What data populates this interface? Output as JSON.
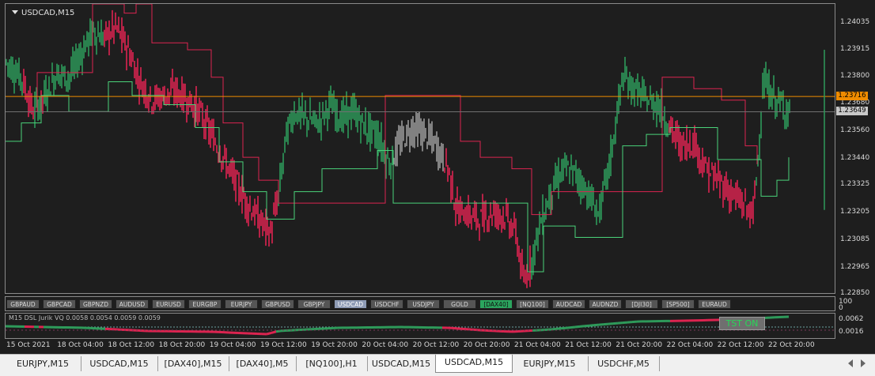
{
  "window": {
    "symbol_title": "USDCAD,M15"
  },
  "chart_data": {
    "type": "candlestick",
    "symbol": "USDCAD",
    "timeframe": "M15",
    "ylim": [
      1.2285,
      1.2412
    ],
    "price_ticks": [
      "1.24035",
      "1.23915",
      "1.23800",
      "1.23680",
      "1.23560",
      "1.23440",
      "1.23325",
      "1.23205",
      "1.23085",
      "1.22965",
      "1.22850"
    ],
    "bid_price": "1.23649",
    "bid_value": 1.23649,
    "horizontal_line_price": "1.23716",
    "horizontal_line_value": 1.23716,
    "time_labels": [
      "15 Oct 2021",
      "18 Oct 04:00",
      "18 Oct 12:00",
      "18 Oct 20:00",
      "19 Oct 04:00",
      "19 Oct 12:00",
      "19 Oct 20:00",
      "20 Oct 04:00",
      "20 Oct 12:00",
      "20 Oct 20:00",
      "21 Oct 04:00",
      "21 Oct 12:00",
      "21 Oct 20:00",
      "22 Oct 04:00",
      "22 Oct 12:00",
      "22 Oct 20:00"
    ],
    "close_path": [
      [
        0,
        1.2387
      ],
      [
        20,
        1.238
      ],
      [
        35,
        1.2365
      ],
      [
        50,
        1.2372
      ],
      [
        65,
        1.2382
      ],
      [
        80,
        1.238
      ],
      [
        95,
        1.239
      ],
      [
        110,
        1.24
      ],
      [
        125,
        1.2397
      ],
      [
        140,
        1.2402
      ],
      [
        155,
        1.2392
      ],
      [
        170,
        1.2378
      ],
      [
        185,
        1.237
      ],
      [
        200,
        1.2372
      ],
      [
        215,
        1.2374
      ],
      [
        230,
        1.237
      ],
      [
        245,
        1.2365
      ],
      [
        260,
        1.2355
      ],
      [
        275,
        1.2345
      ],
      [
        290,
        1.2335
      ],
      [
        305,
        1.2325
      ],
      [
        320,
        1.2318
      ],
      [
        335,
        1.2312
      ],
      [
        345,
        1.2328
      ],
      [
        355,
        1.2355
      ],
      [
        365,
        1.2365
      ],
      [
        380,
        1.2362
      ],
      [
        395,
        1.236
      ],
      [
        410,
        1.2368
      ],
      [
        425,
        1.2362
      ],
      [
        440,
        1.2365
      ],
      [
        455,
        1.2358
      ],
      [
        470,
        1.2355
      ],
      [
        485,
        1.2342
      ],
      [
        500,
        1.2352
      ],
      [
        515,
        1.2358
      ],
      [
        530,
        1.2355
      ],
      [
        545,
        1.235
      ],
      [
        560,
        1.234
      ],
      [
        570,
        1.2322
      ],
      [
        585,
        1.232
      ],
      [
        600,
        1.2318
      ],
      [
        615,
        1.2321
      ],
      [
        630,
        1.232
      ],
      [
        645,
        1.2312
      ],
      [
        655,
        1.229
      ],
      [
        665,
        1.23
      ],
      [
        675,
        1.2315
      ],
      [
        690,
        1.233
      ],
      [
        705,
        1.234
      ],
      [
        720,
        1.2338
      ],
      [
        735,
        1.233
      ],
      [
        750,
        1.232
      ],
      [
        765,
        1.2345
      ],
      [
        780,
        1.238
      ],
      [
        795,
        1.2375
      ],
      [
        810,
        1.237
      ],
      [
        825,
        1.2368
      ],
      [
        840,
        1.2358
      ],
      [
        855,
        1.235
      ],
      [
        870,
        1.2352
      ],
      [
        885,
        1.234
      ],
      [
        900,
        1.2335
      ],
      [
        915,
        1.233
      ],
      [
        930,
        1.2325
      ],
      [
        945,
        1.232
      ],
      [
        950,
        1.234
      ],
      [
        958,
        1.2378
      ],
      [
        968,
        1.2372
      ],
      [
        980,
        1.2368
      ],
      [
        992,
        1.2365
      ]
    ],
    "trend_down_segments": [
      [
        22,
        36
      ],
      [
        44,
        48
      ],
      [
        125,
        345
      ],
      [
        555,
        665
      ],
      [
        838,
        948
      ]
    ],
    "trend_up_segments": [
      [
        0,
        22
      ],
      [
        48,
        125
      ],
      [
        345,
        490
      ],
      [
        665,
        838
      ],
      [
        948,
        992
      ]
    ],
    "neutral_segments": [
      [
        490,
        555
      ]
    ],
    "upper_band": [
      [
        30,
        1.2365
      ],
      [
        40,
        1.2382
      ],
      [
        60,
        1.2382
      ],
      [
        110,
        1.2412
      ],
      [
        130,
        1.2412
      ],
      [
        150,
        1.2408
      ],
      [
        165,
        1.2412
      ],
      [
        185,
        1.2395
      ],
      [
        230,
        1.2392
      ],
      [
        260,
        1.238
      ],
      [
        275,
        1.236
      ],
      [
        300,
        1.2345
      ],
      [
        320,
        1.2335
      ],
      [
        345,
        1.2325
      ],
      [
        480,
        1.2372
      ],
      [
        560,
        1.2372
      ],
      [
        575,
        1.2352
      ],
      [
        600,
        1.2345
      ],
      [
        640,
        1.234
      ],
      [
        665,
        1.232
      ],
      [
        690,
        1.233
      ],
      [
        830,
        1.238
      ],
      [
        870,
        1.2375
      ],
      [
        905,
        1.237
      ],
      [
        935,
        1.235
      ],
      [
        950,
        1.2342
      ]
    ],
    "lower_band": [
      [
        0,
        1.2352
      ],
      [
        20,
        1.236
      ],
      [
        45,
        1.2372
      ],
      [
        80,
        1.2365
      ],
      [
        130,
        1.2378
      ],
      [
        160,
        1.2372
      ],
      [
        180,
        1.2372
      ],
      [
        200,
        1.2368
      ],
      [
        240,
        1.2358
      ],
      [
        270,
        1.2343
      ],
      [
        300,
        1.233
      ],
      [
        330,
        1.2318
      ],
      [
        345,
        1.2318
      ],
      [
        365,
        1.233
      ],
      [
        400,
        1.234
      ],
      [
        470,
        1.2348
      ],
      [
        490,
        1.2325
      ],
      [
        555,
        1.2325
      ],
      [
        660,
        1.2295
      ],
      [
        680,
        1.2315
      ],
      [
        720,
        1.231
      ],
      [
        780,
        1.235
      ],
      [
        810,
        1.2355
      ],
      [
        840,
        1.2358
      ],
      [
        900,
        1.2344
      ],
      [
        940,
        1.2344
      ],
      [
        955,
        1.2328
      ],
      [
        975,
        1.2335
      ],
      [
        990,
        1.2345
      ]
    ],
    "volume_bar": {
      "x": 1035,
      "low": 1.2322,
      "high": 1.2392
    }
  },
  "symbol_buttons": [
    "GBPAUD",
    "GBPCAD",
    "GBPNZD",
    "AUDUSD",
    "EURUSD",
    "EURGBP",
    "EURJPY",
    "GBPUSD",
    "GBPJPY",
    "USDCAD",
    "USDCHF",
    "USDJPY",
    "GOLD",
    "[DAX40]",
    "[NQ100]",
    "AUDCAD",
    "AUDNZD",
    "[DJI30]",
    "[SP500]",
    "EURAUD"
  ],
  "symbol_button_active": "USDCAD",
  "symbol_button_highlight": "[DAX40]",
  "subwindow": {
    "label": "M15 DSL Jurik VQ 0.0058 0.0054 0.0059 0.0059",
    "ticks": [
      "100",
      "0",
      "0.0062",
      "0.0016"
    ],
    "tst_badge": "TST ON",
    "tst_color": "#27d857"
  },
  "tabs": [
    "EURJPY,M15",
    "USDCAD,M15",
    "[DAX40],M15",
    "[DAX40],M5",
    "[NQ100],H1",
    "USDCAD,M15",
    "USDCAD,M15",
    "EURJPY,M15",
    "USDCHF,M5"
  ],
  "active_tab_index": 6,
  "colors": {
    "bull": "#2e9a5a",
    "bear": "#dc2450",
    "neutral": "#9a9a9a",
    "band_down": "#dc2450",
    "band_up": "#4ad27a",
    "orange_line": "#f08c00",
    "bid_tag": "#c8c8c8"
  }
}
